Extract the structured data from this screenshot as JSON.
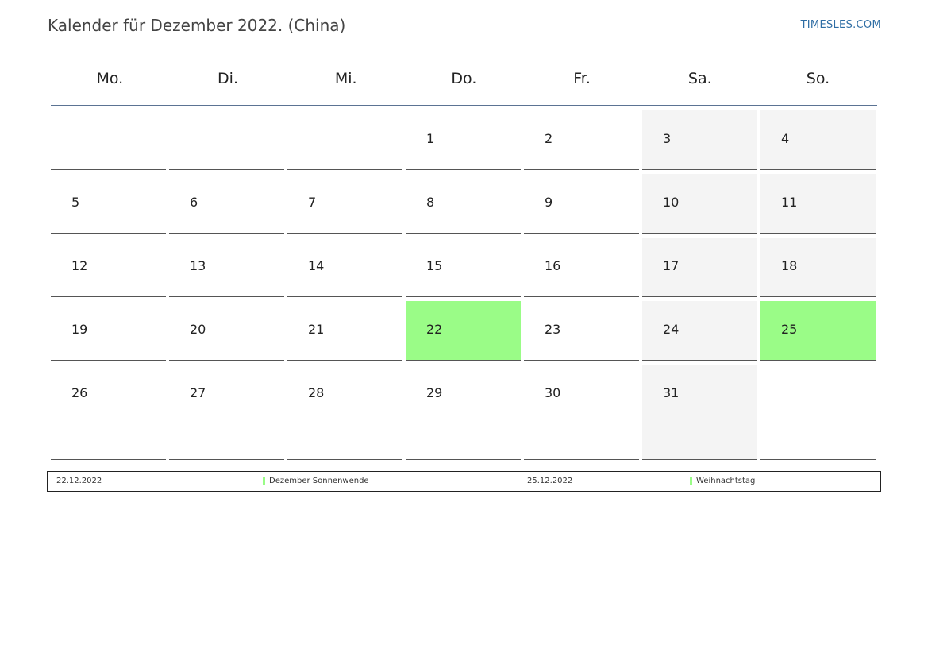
{
  "header": {
    "title": "Kalender für Dezember 2022. (China)",
    "site": "TIMESLES.COM"
  },
  "weekdays": [
    "Mo.",
    "Di.",
    "Mi.",
    "Do.",
    "Fr.",
    "Sa.",
    "So."
  ],
  "weeks": [
    [
      "",
      "",
      "",
      "1",
      "2",
      "3",
      "4"
    ],
    [
      "5",
      "6",
      "7",
      "8",
      "9",
      "10",
      "11"
    ],
    [
      "12",
      "13",
      "14",
      "15",
      "16",
      "17",
      "18"
    ],
    [
      "19",
      "20",
      "21",
      "22",
      "23",
      "24",
      "25"
    ],
    [
      "26",
      "27",
      "28",
      "29",
      "30",
      "31",
      ""
    ]
  ],
  "colors": {
    "holiday": "#9afc87",
    "weekend": "#f4f4f4",
    "header_line": "#5b7393",
    "link": "#2e6da4"
  },
  "legend": [
    {
      "date": "22.12.2022",
      "name": "Dezember Sonnenwende"
    },
    {
      "date": "25.12.2022",
      "name": "Weihnachtstag"
    }
  ]
}
